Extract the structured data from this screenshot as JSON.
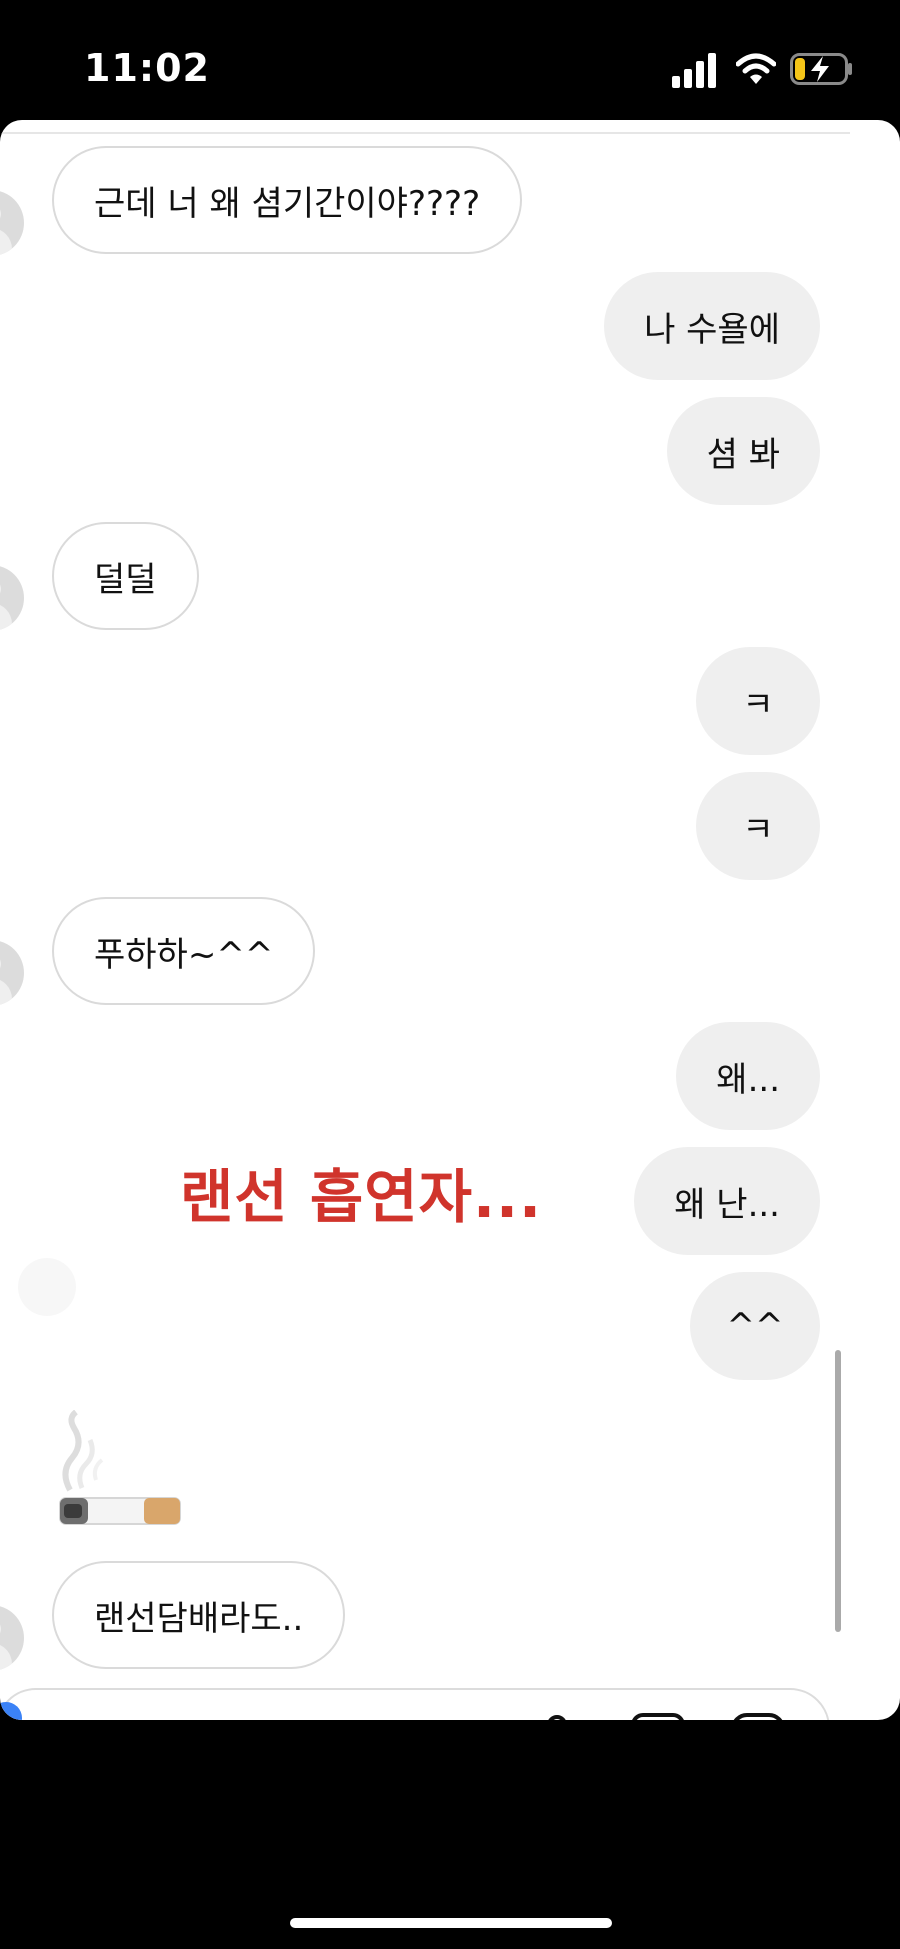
{
  "status_bar": {
    "time": "11:02",
    "icons": [
      "signal-icon",
      "wifi-icon",
      "battery-charging-icon"
    ],
    "battery_color": "#f5c518"
  },
  "messages": [
    {
      "side": "in",
      "text": "근데 너 왜 셤기간이야????"
    },
    {
      "side": "out",
      "text": "나 수욜에"
    },
    {
      "side": "out",
      "text": "셤 봐"
    },
    {
      "side": "in",
      "text": "덜덜"
    },
    {
      "side": "out",
      "text": "ㅋ"
    },
    {
      "side": "out",
      "text": "ㅋ"
    },
    {
      "side": "in",
      "text": "푸하하~^^"
    },
    {
      "side": "out",
      "text": "왜..."
    },
    {
      "side": "out",
      "text": "왜 난..."
    },
    {
      "side": "out",
      "text": "^^"
    },
    {
      "side": "in",
      "text": "랜선담배라도.."
    }
  ],
  "overlay_caption": "랜선 흡연자...",
  "overlay_color": "#d0342c",
  "emoji": "cigarette-with-smoke",
  "composer": {
    "icons": [
      "camera-icon",
      "microphone-icon",
      "gallery-icon",
      "sticker-icon"
    ]
  }
}
